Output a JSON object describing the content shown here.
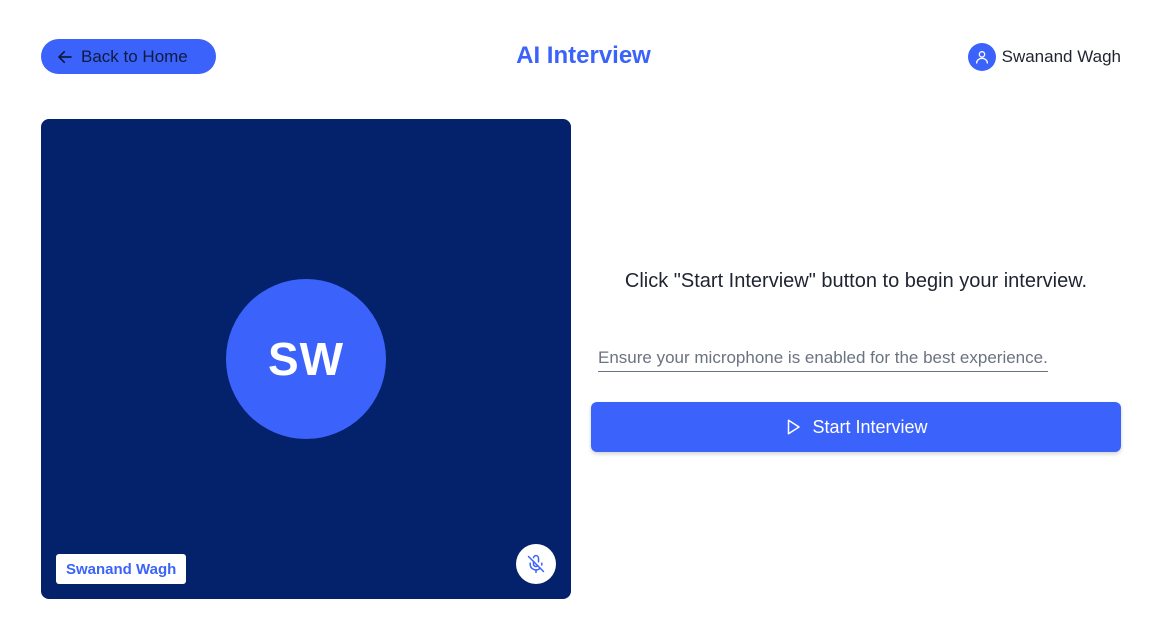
{
  "header": {
    "back_label": "Back to Home",
    "title": "AI Interview",
    "user_name": "Swanand Wagh"
  },
  "video": {
    "initials": "SW",
    "name_tag": "Swanand Wagh",
    "mic_state": "muted"
  },
  "panel": {
    "instructions": "Click \"Start Interview\" button to begin your interview.",
    "hint": "Ensure your microphone is enabled for the best experience.",
    "start_label": "Start Interview"
  },
  "colors": {
    "accent": "#3b63fb",
    "video_bg": "#04216b",
    "hint_text": "#6b7280"
  },
  "icons": {
    "back": "arrow-left-icon",
    "user": "user-icon",
    "mic": "mic-off-icon",
    "start": "play-icon"
  }
}
